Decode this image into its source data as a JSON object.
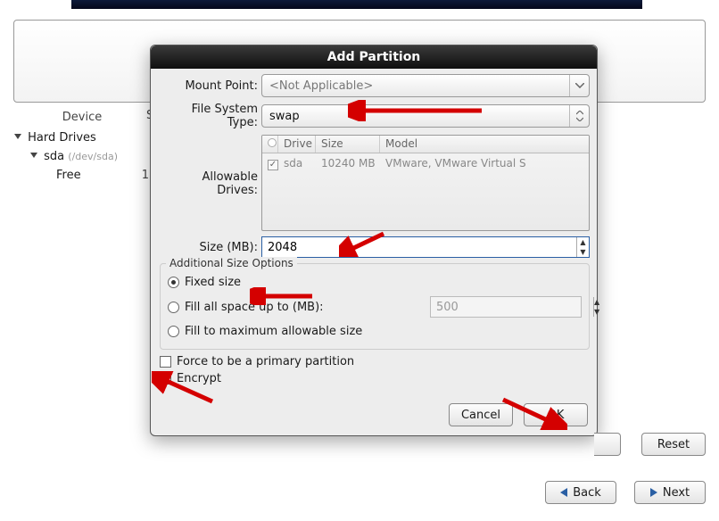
{
  "top": {},
  "device_col_header": "Device",
  "tree": {
    "root": "Hard Drives",
    "drive": "sda",
    "drive_devpath": "(/dev/sda)",
    "free": "Free"
  },
  "side_frag": "S",
  "dialog": {
    "title": "Add Partition",
    "mount_point": {
      "label": "Mount Point:",
      "value": "<Not Applicable>"
    },
    "fs_type": {
      "label": "File System Type:",
      "value": "swap"
    },
    "allowable_drives": {
      "label": "Allowable Drives:",
      "columns": {
        "drive": "Drive",
        "size": "Size",
        "model": "Model"
      },
      "rows": [
        {
          "drive": "sda",
          "size": "10240 MB",
          "model": "VMware, VMware Virtual S"
        }
      ]
    },
    "size": {
      "label": "Size (MB):",
      "value": "2048"
    },
    "size_options": {
      "legend": "Additional Size Options",
      "fixed": "Fixed size",
      "fill_up_to": "Fill all space up to (MB):",
      "fill_up_to_value": "500",
      "fill_max": "Fill to maximum allowable size"
    },
    "primary_label": "Force to be a primary partition",
    "encrypt_label": "Encrypt",
    "cancel": "Cancel",
    "ok": "OK"
  },
  "bottom": {
    "reset": "Reset",
    "back": "Back",
    "next": "Next"
  }
}
